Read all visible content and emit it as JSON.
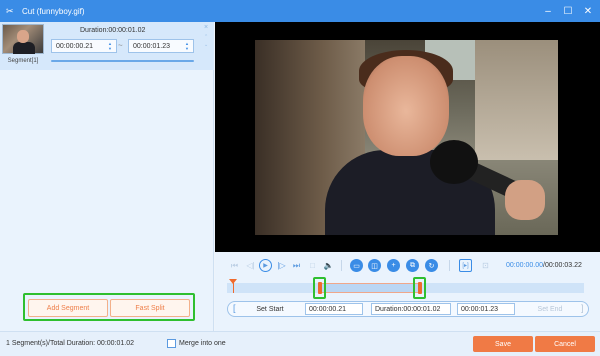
{
  "window": {
    "title": "Cut (funnyboy.gif)",
    "app_icon": "scissors-icon",
    "minimize_icon": "minimize-icon",
    "maximize_icon": "maximize-icon",
    "close_icon": "close-icon"
  },
  "segment": {
    "label": "Segment[1]",
    "duration": "Duration:00:00:01.02",
    "start": "00:00:00.21",
    "separator": "~",
    "end": "00:00:01.23",
    "close_glyph": "×"
  },
  "left_actions": {
    "add_segment": "Add Segment",
    "fast_split": "Fast Split"
  },
  "player": {
    "current_time": "00:00:00.00",
    "time_separator": "/",
    "total_time": "00:00:03.22",
    "progress": 0.0
  },
  "trim": {
    "start_fraction": 0.26,
    "end_fraction": 0.54,
    "set_start": "Set Start",
    "start_value": "00:00:00.21",
    "duration_value": "Duration:00:00:01.02",
    "end_value": "00:00:01.23",
    "set_end": "Set End"
  },
  "footer": {
    "summary": "1 Segment(s)/Total Duration: 00:00:01.02",
    "merge_label": "Merge into one",
    "merge_checked": false,
    "save": "Save",
    "cancel": "Cancel"
  },
  "colors": {
    "accent": "#3a8ce6",
    "action": "#f07a45",
    "highlight_box": "#2fbf2f"
  }
}
